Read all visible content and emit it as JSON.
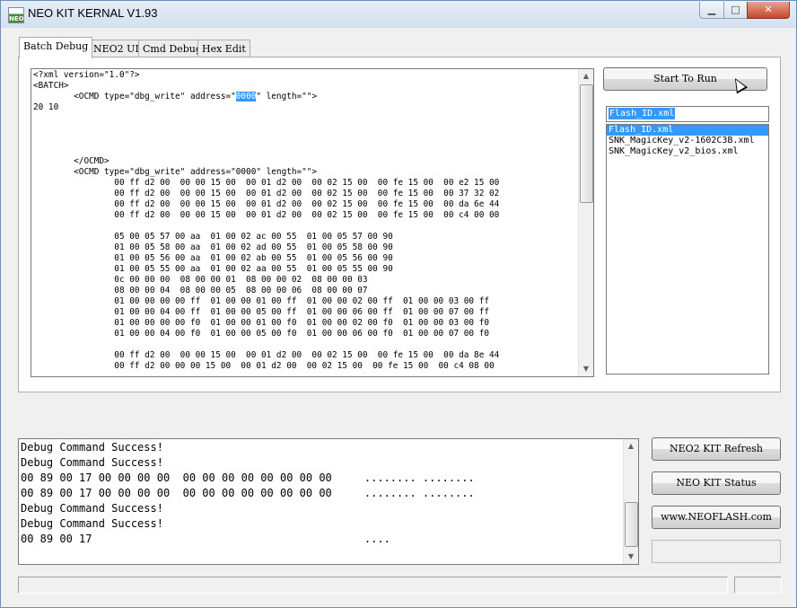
{
  "window": {
    "title": "NEO KIT KERNAL V1.93",
    "app_icon_text": "NEO",
    "min_glyph": "▁",
    "max_glyph": "□",
    "close_glyph": "✕"
  },
  "tabs": [
    {
      "label": "Batch Debug",
      "active": true
    },
    {
      "label": "NEO2 UI",
      "active": false
    },
    {
      "label": "Cmd Debug",
      "active": false
    },
    {
      "label": "Hex Edit",
      "active": false
    }
  ],
  "editor": {
    "lines": [
      "<?xml version=\"1.0\"?>",
      "<BATCH>",
      "        <OCMD type=\"dbg_write\" address=\"0000\" length=\"\">",
      "20 10",
      "",
      "",
      "",
      "",
      "        </OCMD>",
      "        <OCMD type=\"dbg_write\" address=\"0000\" length=\"\">",
      "                00 ff d2 00  00 00 15 00  00 01 d2 00  00 02 15 00  00 fe 15 00  00 e2 15 00",
      "                00 ff d2 00  00 00 15 00  00 01 d2 00  00 02 15 00  00 fe 15 00  00 37 32 02",
      "                00 ff d2 00  00 00 15 00  00 01 d2 00  00 02 15 00  00 fe 15 00  00 da 6e 44",
      "                00 ff d2 00  00 00 15 00  00 01 d2 00  00 02 15 00  00 fe 15 00  00 c4 00 00",
      "",
      "                05 00 05 57 00 aa  01 00 02 ac 00 55  01 00 05 57 00 90",
      "                01 00 05 58 00 aa  01 00 02 ad 00 55  01 00 05 58 00 90",
      "                01 00 05 56 00 aa  01 00 02 ab 00 55  01 00 05 56 00 90",
      "                01 00 05 55 00 aa  01 00 02 aa 00 55  01 00 05 55 00 90",
      "                0c 00 00 00  08 00 00 01  08 00 00 02  08 00 00 03",
      "                08 00 00 04  08 00 00 05  08 00 00 06  08 00 00 07",
      "                01 00 00 00 00 ff  01 00 00 01 00 ff  01 00 00 02 00 ff  01 00 00 03 00 ff",
      "                01 00 00 04 00 ff  01 00 00 05 00 ff  01 00 00 06 00 ff  01 00 00 07 00 ff",
      "                01 00 00 00 00 f0  01 00 00 01 00 f0  01 00 00 02 00 f0  01 00 00 03 00 f0",
      "                01 00 00 04 00 f0  01 00 00 05 00 f0  01 00 00 06 00 f0  01 00 00 07 00 f0",
      "",
      "                00 ff d2 00  00 00 15 00  00 01 d2 00  00 02 15 00  00 fe 15 00  00 da 8e 44",
      "                00 ff d2 00 00 00 15 00  00 01 d2 00  00 02 15 00  00 fe 15 00  00 c4 08 00"
    ],
    "selected_text": "0000",
    "scroll_position": 0.33
  },
  "run_button": {
    "label": "Start To Run"
  },
  "file_input": {
    "value": "Flash_ID.xml"
  },
  "file_list": {
    "items": [
      "Flash_ID.xml",
      "SNK_MagicKey_v2-1602C3B.xml",
      "SNK_MagicKey_v2_bios.xml"
    ],
    "selected_index": 0
  },
  "log": {
    "lines": [
      "Debug Command Success!",
      "Debug Command Success!",
      "00 89 00 17 00 00 00 00  00 00 00 00 00 00 00 00     ........ ........",
      "00 89 00 17 00 00 00 00  00 00 00 00 00 00 00 00     ........ ........",
      "Debug Command Success!",
      "Debug Command Success!",
      "00 89 00 17                                          ...."
    ],
    "scroll_position": 0.8
  },
  "side_buttons": {
    "refresh_label": "NEO2 KIT Refresh",
    "status_label": "NEO KIT Status",
    "website_label": "www.NEOFLASH.com"
  },
  "scroll_glyphs": {
    "up": "▲",
    "down": "▼"
  }
}
